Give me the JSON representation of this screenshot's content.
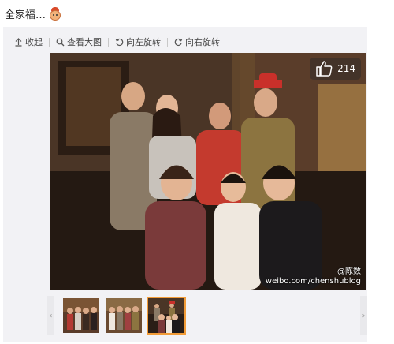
{
  "post": {
    "text": "全家福…",
    "emoji_icon": "baby-emoji-icon"
  },
  "toolbar": {
    "collapse_label": "收起",
    "view_large_label": "查看大图",
    "rotate_left_label": "向左旋转",
    "rotate_right_label": "向右旋转"
  },
  "photo": {
    "like_count": "214",
    "watermark_line1": "@陈数",
    "watermark_line2": "weibo.com/chenshublog"
  },
  "thumbnails": {
    "count": 3,
    "active_index": 3,
    "prev_icon": "chevron-left-icon",
    "next_icon": "chevron-right-icon"
  },
  "colors": {
    "accent": "#f29c38",
    "panel": "#f2f2f5"
  }
}
